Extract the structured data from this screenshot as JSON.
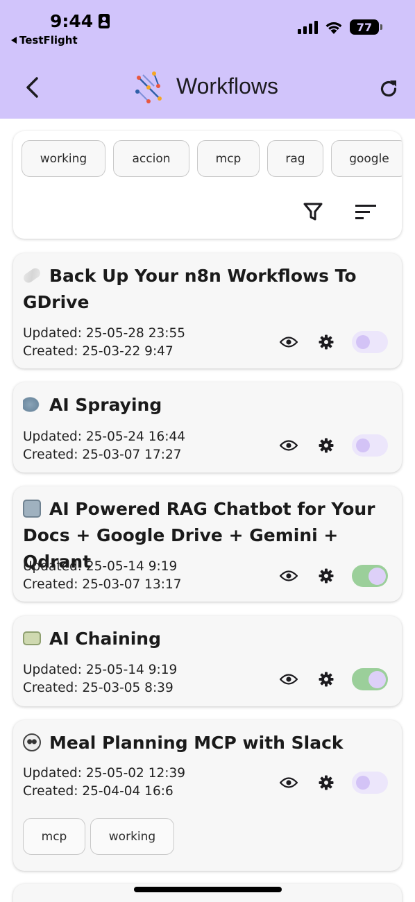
{
  "status_bar": {
    "time": "9:44",
    "back_app": "TestFlight",
    "battery": "77"
  },
  "app_bar": {
    "title": "Workflows"
  },
  "filters": {
    "tags": [
      "working",
      "accion",
      "mcp",
      "rag",
      "google"
    ]
  },
  "workflows": [
    {
      "title": "Back Up Your n8n Workflows To GDrive",
      "updated": "Updated: 25-05-28 23:55",
      "created": "Created: 25-03-22 9:47",
      "active": false,
      "emoji_icon": "bandage-icon"
    },
    {
      "title": "AI Spraying",
      "updated": "Updated: 25-05-24 16:44",
      "created": "Created: 25-03-07 17:27",
      "active": false,
      "emoji_icon": "shark-icon"
    },
    {
      "title": "AI Powered RAG Chatbot for Your Docs + Google Drive + Gemini + Qdrant",
      "updated": "Updated: 25-05-14 9:19",
      "created": "Created: 25-03-07 13:17",
      "active": true,
      "emoji_icon": "robot-icon"
    },
    {
      "title": "AI Chaining",
      "updated": "Updated: 25-05-14 9:19",
      "created": "Created: 25-03-05 8:39",
      "active": true,
      "emoji_icon": "money-icon"
    },
    {
      "title": "Meal Planning MCP with Slack",
      "updated": "Updated: 25-05-02 12:39",
      "created": "Created: 25-04-04 16:6",
      "active": false,
      "emoji_icon": "panda-icon",
      "tags": [
        "mcp",
        "working"
      ]
    }
  ],
  "colors": {
    "header_bg": "#d1c4fb",
    "toggle_on": "#9bcf9a",
    "toggle_off": "#ece6fb"
  }
}
